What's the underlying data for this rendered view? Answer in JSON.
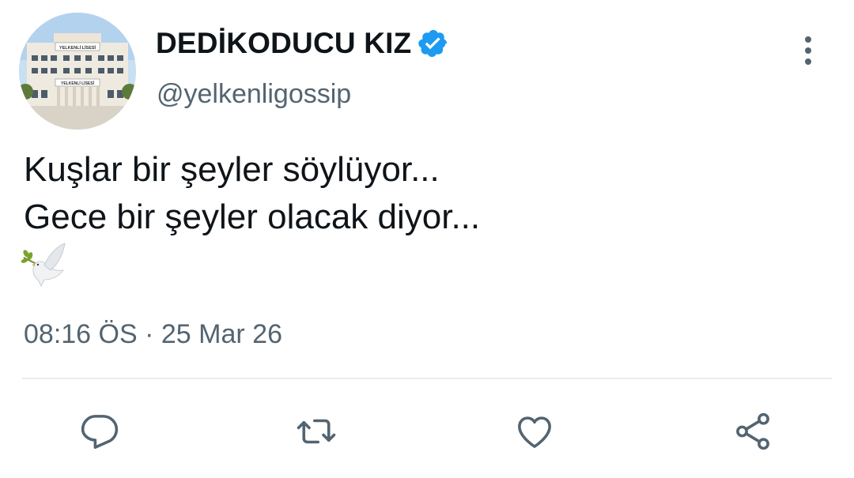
{
  "author": {
    "display_name": "DEDİKODUCU KIZ",
    "handle": "@yelkenligossip",
    "verified": true,
    "avatar_sign_top": "YELKENLİ LİSESİ",
    "avatar_sign_bottom": "YELKENLİ LİSESİ"
  },
  "tweet": {
    "lines": [
      "Kuşlar bir şeyler söylüyor...",
      "Gece bir şeyler olacak diyor..."
    ],
    "emoji": "dove-with-olive-branch",
    "time": "08:16 ÖS",
    "separator": "·",
    "date": "25 Mar 26"
  },
  "actions": {
    "icons": [
      "reply-icon",
      "retweet-icon",
      "like-icon",
      "share-icon"
    ]
  },
  "colors": {
    "verified_blue": "#1d9bf0",
    "text_primary": "#0f1419",
    "text_secondary": "#536471",
    "divider": "#e6ecf0"
  }
}
